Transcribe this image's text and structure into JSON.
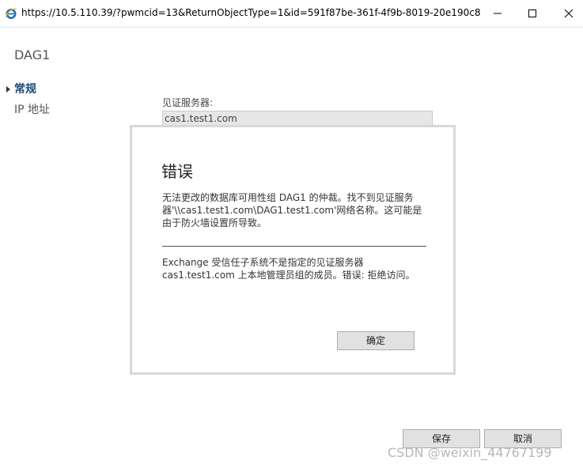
{
  "browser": {
    "url": "https://10.5.110.39/?pwmcid=13&ReturnObjectType=1&id=591f87be-361f-4f9b-8019-20e190c84...",
    "icon": "ie-icon"
  },
  "app": {
    "title": "DAG1"
  },
  "nav": {
    "items": [
      {
        "label": "常规"
      },
      {
        "label": "IP 地址"
      }
    ]
  },
  "form": {
    "witness_label": "见证服务器:",
    "witness_value": "cas1.test1.com"
  },
  "dialog": {
    "title": "错误",
    "message": "无法更改的数据库可用性组 DAG1 的仲裁。找不到见证服务器'\\\\cas1.test1.com\\DAG1.test1.com'网络名称。这可能是由于防火墙设置所导致。",
    "detail": "Exchange 受信任子系统不是指定的见证服务器 cas1.test1.com 上本地管理员组的成员。错误: 拒绝访问。",
    "ok_label": "确定"
  },
  "footer": {
    "save_label": "保存",
    "cancel_label": "取消"
  },
  "watermark": "CSDN @weixin_44767199",
  "colors": {
    "nav_active": "#1a4a7a",
    "ie_blue": "#1e73be",
    "ie_ring": "#f2b400"
  }
}
